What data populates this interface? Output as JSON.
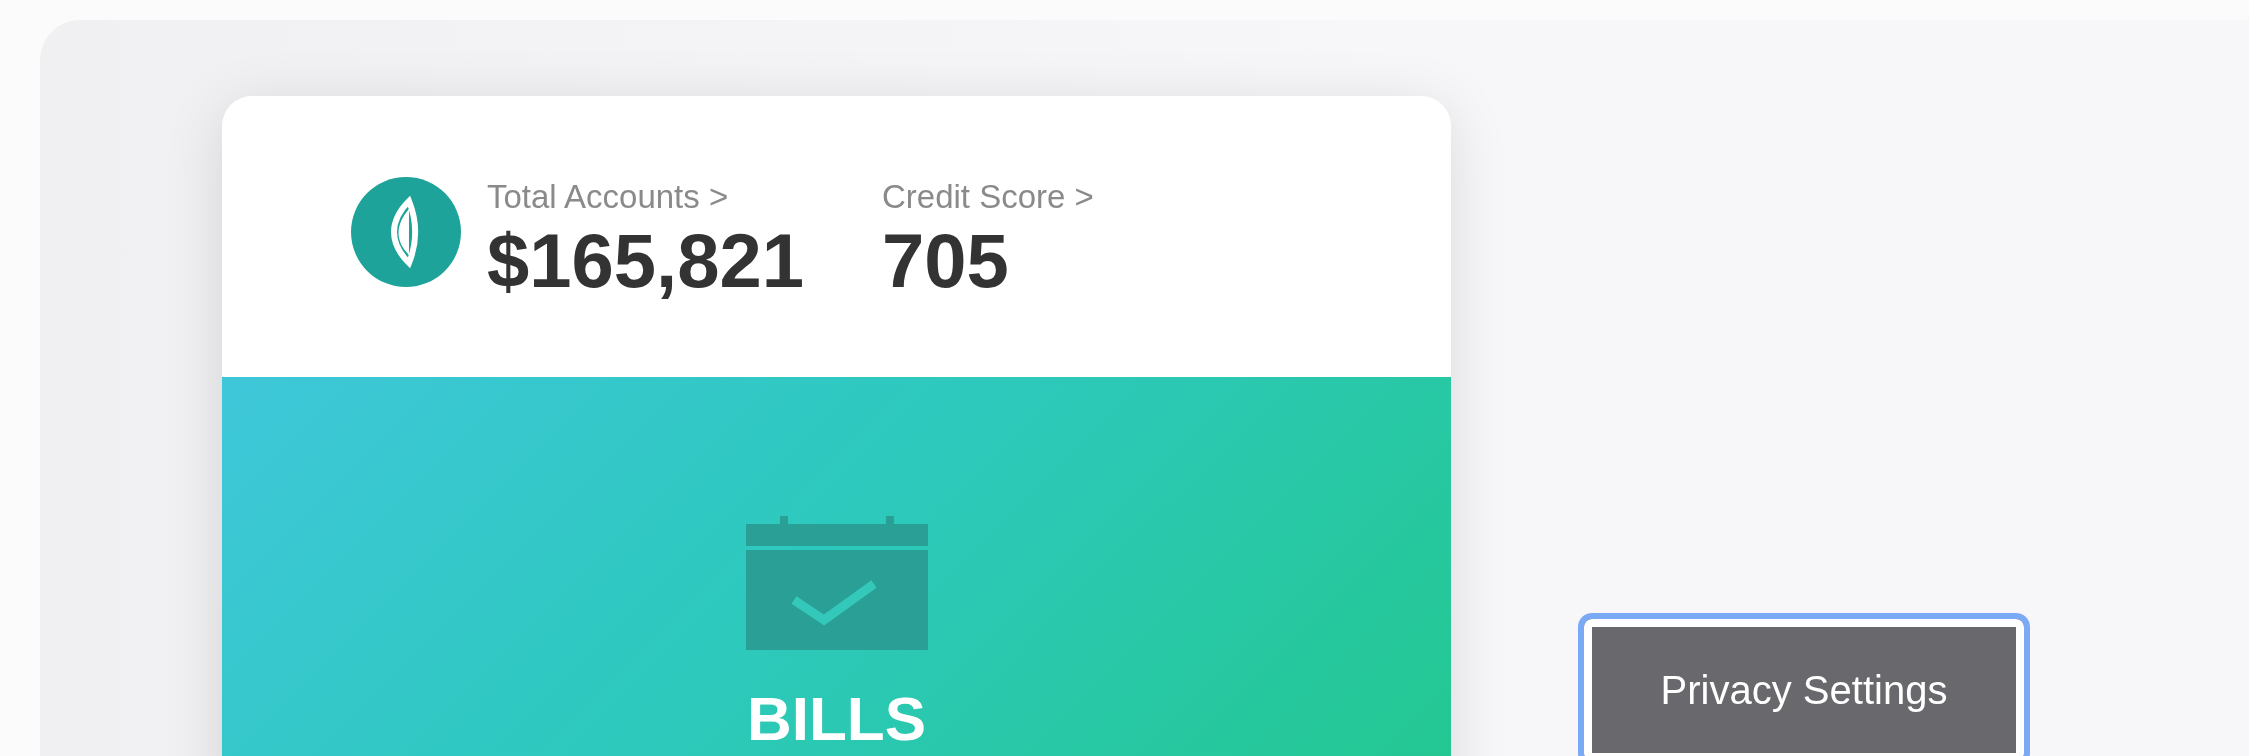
{
  "summary": {
    "accounts_label": "Total Accounts >",
    "accounts_value": "$165,821",
    "credit_label": "Credit Score >",
    "credit_value": "705"
  },
  "feature": {
    "title": "BILLS"
  },
  "privacy_button": {
    "label": "Privacy Settings",
    "focused": true
  }
}
